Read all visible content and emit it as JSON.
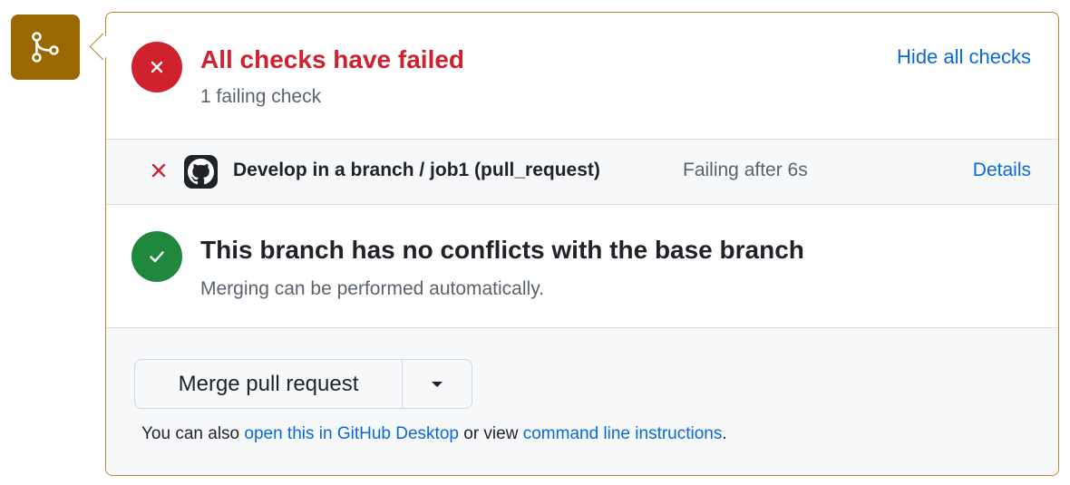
{
  "icons": {
    "merge_badge": "git-merge-icon",
    "fail": "x-icon",
    "ok": "check-icon",
    "github": "github-mark-icon",
    "dropdown": "triangle-down-icon"
  },
  "colors": {
    "badge": "#9a6700",
    "panel_border": "#b38628",
    "danger": "#cf222e",
    "success": "#1f883d",
    "link": "#0969da",
    "muted": "#59636e"
  },
  "checks": {
    "title": "All checks have failed",
    "subtitle": "1 failing check",
    "hide_all": "Hide all checks"
  },
  "check_row": {
    "name": "Develop in a branch / job1 (pull_request)",
    "meta": "Failing after 6s",
    "details": "Details"
  },
  "conflicts": {
    "title": "This branch has no conflicts with the base branch",
    "subtitle": "Merging can be performed automatically."
  },
  "merge": {
    "button_label": "Merge pull request",
    "note_prefix": "You can also ",
    "desktop_link": "open this in GitHub Desktop",
    "note_middle": " or view ",
    "cli_link": "command line instructions",
    "note_suffix": "."
  }
}
